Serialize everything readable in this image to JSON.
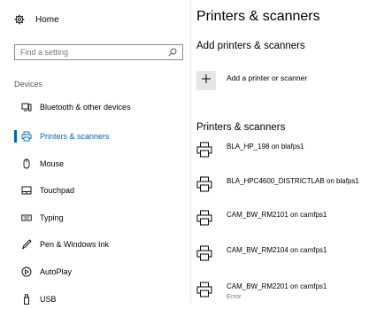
{
  "sidebar": {
    "home_label": "Home",
    "search_placeholder": "Find a setting",
    "section_label": "Devices",
    "items": [
      {
        "label": "Bluetooth & other devices",
        "icon": "bluetooth-devices-icon"
      },
      {
        "label": "Printers & scanners",
        "icon": "printer-icon",
        "selected": true
      },
      {
        "label": "Mouse",
        "icon": "mouse-icon"
      },
      {
        "label": "Touchpad",
        "icon": "touchpad-icon"
      },
      {
        "label": "Typing",
        "icon": "keyboard-icon"
      },
      {
        "label": "Pen & Windows Ink",
        "icon": "pen-icon"
      },
      {
        "label": "AutoPlay",
        "icon": "autoplay-icon"
      },
      {
        "label": "USB",
        "icon": "usb-icon"
      }
    ]
  },
  "main": {
    "title": "Printers & scanners",
    "add_heading": "Add printers & scanners",
    "add_label": "Add a printer or scanner",
    "list_heading": "Printers & scanners",
    "printers": [
      {
        "name": "BLA_HP_198 on blafps1",
        "status": ""
      },
      {
        "name": "BLA_HPC4600_DISTRICTLAB on blafps1",
        "status": ""
      },
      {
        "name": "CAM_BW_RM2101 on camfps1",
        "status": ""
      },
      {
        "name": "CAM_BW_RM2104 on camfps1",
        "status": ""
      },
      {
        "name": "CAM_BW_RM2201 on camfps1",
        "status": "Error"
      }
    ]
  },
  "colors": {
    "accent": "#0063b1"
  }
}
